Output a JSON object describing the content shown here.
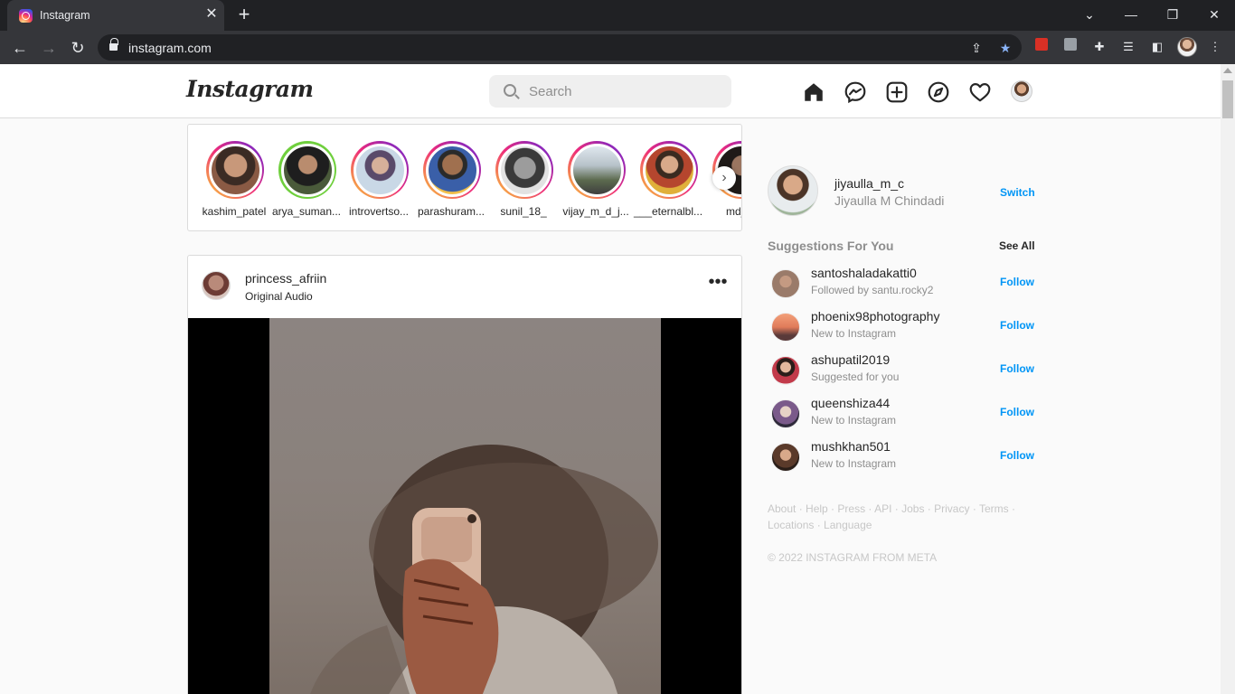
{
  "browser": {
    "tab_title": "Instagram",
    "url": "instagram.com",
    "tab_close": "✕",
    "new_tab": "+"
  },
  "ig": {
    "logo": "Instagram",
    "search_placeholder": "Search",
    "nav_icons": [
      "home-icon",
      "messenger-icon",
      "new-post-icon",
      "explore-icon",
      "heart-icon"
    ]
  },
  "stories": [
    {
      "label": "kashim_patel",
      "ring": "gradient",
      "tone": "#8a5a44"
    },
    {
      "label": "arya_suman...",
      "ring": "green",
      "tone": "#4a5a3a"
    },
    {
      "label": "introvertso...",
      "ring": "gradient",
      "tone": "#c9b3a8"
    },
    {
      "label": "parashuram...",
      "ring": "gradient",
      "tone": "#3a5fa8"
    },
    {
      "label": "sunil_18_",
      "ring": "gradient",
      "tone": "#6b6b6b"
    },
    {
      "label": "vijay_m_d_j...",
      "ring": "gradient",
      "tone": "#7a8a6a"
    },
    {
      "label": "___eternalbl...",
      "ring": "gradient",
      "tone": "#b5462e"
    },
    {
      "label": "md_si",
      "ring": "gradient",
      "tone": "#3b2e2a"
    }
  ],
  "post": {
    "username": "princess_afriin",
    "audio": "Original Audio",
    "more": "•••"
  },
  "sidebar": {
    "me_username": "jiyaulla_m_c",
    "me_name": "Jiyaulla M Chindadi",
    "switch_label": "Switch",
    "suggestions_title": "Suggestions For You",
    "see_all_label": "See All",
    "suggestions": [
      {
        "username": "santoshaladakatti0",
        "sub": "Followed by santu.rocky2",
        "action": "Follow",
        "tone": "#9a7b6a"
      },
      {
        "username": "phoenix98photography",
        "sub": "New to Instagram",
        "action": "Follow",
        "tone": "#e07b5a"
      },
      {
        "username": "ashupatil2019",
        "sub": "Suggested for you",
        "action": "Follow",
        "tone": "#c23a4a"
      },
      {
        "username": "queenshiza44",
        "sub": "New to Instagram",
        "action": "Follow",
        "tone": "#7a5a8a"
      },
      {
        "username": "mushkhan501",
        "sub": "New to Instagram",
        "action": "Follow",
        "tone": "#5a3a2a"
      }
    ],
    "footer_links": [
      "About",
      "Help",
      "Press",
      "API",
      "Jobs",
      "Privacy",
      "Terms",
      "Locations",
      "Language"
    ],
    "copyright": "© 2022 INSTAGRAM FROM META"
  }
}
